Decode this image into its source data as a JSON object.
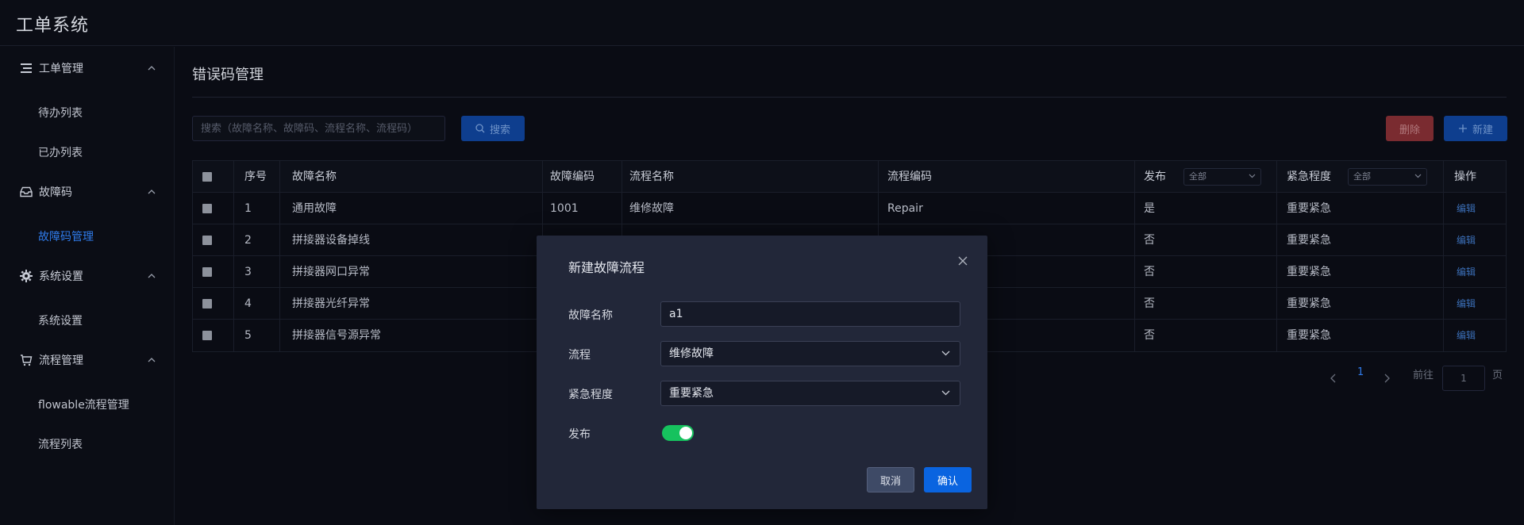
{
  "app": {
    "title": "工单系统"
  },
  "sidebar": {
    "groups": [
      {
        "label": "工单管理",
        "icon": "list-icon",
        "items": [
          "待办列表",
          "已办列表"
        ]
      },
      {
        "label": "故障码",
        "icon": "inbox-icon",
        "items": [
          "故障码管理"
        ]
      },
      {
        "label": "系统设置",
        "icon": "gear-icon",
        "items": [
          "系统设置"
        ]
      },
      {
        "label": "流程管理",
        "icon": "cart-icon",
        "items": [
          "flowable流程管理",
          "流程列表"
        ]
      }
    ],
    "active_item": "故障码管理"
  },
  "page": {
    "title": "错误码管理"
  },
  "toolbar": {
    "search_placeholder": "搜索（故障名称、故障码、流程名称、流程码）",
    "search_label": "搜索",
    "delete_label": "删除",
    "new_label": "新建"
  },
  "table": {
    "headers": {
      "index": "序号",
      "name": "故障名称",
      "code": "故障编码",
      "flow_name": "流程名称",
      "flow_code": "流程编码",
      "publish": "发布",
      "publish_filter": "全部",
      "urgency": "紧急程度",
      "urgency_filter": "全部",
      "action": "操作"
    },
    "rows": [
      {
        "index": "1",
        "name": "通用故障",
        "code": "1001",
        "flow_name": "维修故障",
        "flow_code": "Repair",
        "publish": "是",
        "urgency": "重要紧急",
        "action": "编辑"
      },
      {
        "index": "2",
        "name": "拼接器设备掉线",
        "code": "",
        "flow_name": "",
        "flow_code": "",
        "publish": "否",
        "urgency": "重要紧急",
        "action": "编辑"
      },
      {
        "index": "3",
        "name": "拼接器网口异常",
        "code": "",
        "flow_name": "",
        "flow_code": "",
        "publish": "否",
        "urgency": "重要紧急",
        "action": "编辑"
      },
      {
        "index": "4",
        "name": "拼接器光纤异常",
        "code": "",
        "flow_name": "",
        "flow_code": "",
        "publish": "否",
        "urgency": "重要紧急",
        "action": "编辑"
      },
      {
        "index": "5",
        "name": "拼接器信号源异常",
        "code": "",
        "flow_name": "",
        "flow_code": "",
        "publish": "否",
        "urgency": "重要紧急",
        "action": "编辑"
      }
    ]
  },
  "pagination": {
    "current_page": "1",
    "goto_prefix": "前往",
    "goto_value": "1",
    "goto_suffix": "页"
  },
  "dialog": {
    "title": "新建故障流程",
    "fields": {
      "name_label": "故障名称",
      "name_value": "a1",
      "flow_label": "流程",
      "flow_value": "维修故障",
      "urgency_label": "紧急程度",
      "urgency_value": "重要紧急",
      "publish_label": "发布"
    },
    "publish_on": true,
    "cancel_label": "取消",
    "confirm_label": "确认"
  },
  "colors": {
    "accent": "#0a64e0",
    "toggle_on": "#16c25e",
    "danger": "#7a2b30",
    "active_nav": "#2f7bea"
  }
}
